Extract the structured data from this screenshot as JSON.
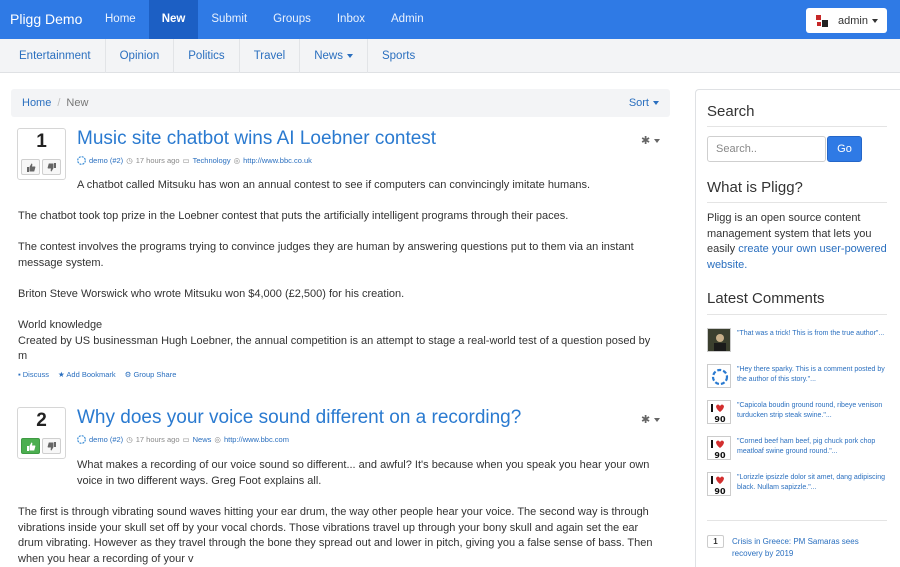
{
  "navbar": {
    "brand": "Pligg Demo",
    "items": [
      {
        "label": "Home",
        "active": false
      },
      {
        "label": "New",
        "active": true
      },
      {
        "label": "Submit",
        "active": false
      },
      {
        "label": "Groups",
        "active": false
      },
      {
        "label": "Inbox",
        "active": false
      },
      {
        "label": "Admin",
        "active": false
      }
    ],
    "user_label": "admin",
    "accent": "#2f7ae5"
  },
  "subnav": {
    "items": [
      "Entertainment",
      "Opinion",
      "Politics",
      "Travel",
      "News",
      "Sports"
    ]
  },
  "breadcrumb": {
    "home": "Home",
    "current": "New",
    "sort_label": "Sort"
  },
  "stories": [
    {
      "votes": "1",
      "voted_up": false,
      "title": "Music site chatbot wins AI Loebner contest",
      "author": "demo (#2)",
      "time": "17 hours ago",
      "category": "Technology",
      "url": "http://www.bbc.co.uk",
      "paragraphs": [
        "A chatbot called Mitsuku has won an annual contest to see if computers can convincingly imitate humans.",
        "The chatbot took top prize in the Loebner contest that puts the artificially intelligent programs through their paces.",
        "The contest involves the programs trying to convince judges they are human by answering questions put to them via an instant message system.",
        "Briton Steve Worswick who wrote Mitsuku won $4,000 (£2,500) for his creation.",
        "World knowledge\nCreated by US businessman Hugh Loebner, the annual competition is an attempt to stage a real-world test of a question posed by m"
      ],
      "actions": [
        "Discuss",
        "Add Bookmark",
        "Group Share"
      ]
    },
    {
      "votes": "2",
      "voted_up": true,
      "title": "Why does your voice sound different on a recording?",
      "author": "demo (#2)",
      "time": "17 hours ago",
      "category": "News",
      "url": "http://www.bbc.com",
      "paragraphs": [
        "What makes a recording of our voice sound so different... and awful? It's because when you speak you hear your own voice in two different ways. Greg Foot explains all.",
        "The first is through vibrating sound waves hitting your ear drum, the way other people hear your voice. The second way is through vibrations inside your skull set off by your vocal chords. Those vibrations travel up through your bony skull and again set the ear drum vibrating. However as they travel through the bone they spread out and lower in pitch, giving you a false sense of bass. Then when you hear a recording of your v"
      ]
    }
  ],
  "sidebar": {
    "search_heading": "Search",
    "search_placeholder": "Search..",
    "go_label": "Go",
    "about_heading": "What is Pligg?",
    "about_text": "Pligg is an open source content management system that lets you easily ",
    "about_link": "create your own user-powered website.",
    "comments_heading": "Latest Comments",
    "comments": [
      {
        "avatar": "photo",
        "text": "\"That was a trick! This is from the true author\"..."
      },
      {
        "avatar": "pligg-icon",
        "text": "\"Hey there sparky. This is a comment posted by the author of this story.\"..."
      },
      {
        "avatar": "i-love-90s",
        "text": "\"Capicola boudin ground round, ribeye venison turducken strip steak swine.\"..."
      },
      {
        "avatar": "i-love-90s",
        "text": "\"Corned beef ham beef, pig chuck pork chop meatloaf swine ground round.\"..."
      },
      {
        "avatar": "i-love-90s",
        "text": "\"Lorizzle ipsizzle dolor sit amet, dang adipiscing black. Nullam sapizzle.\"..."
      }
    ],
    "top_story": {
      "rank": "1",
      "text": "Crisis in Greece: PM Samaras sees recovery by 2019"
    }
  }
}
